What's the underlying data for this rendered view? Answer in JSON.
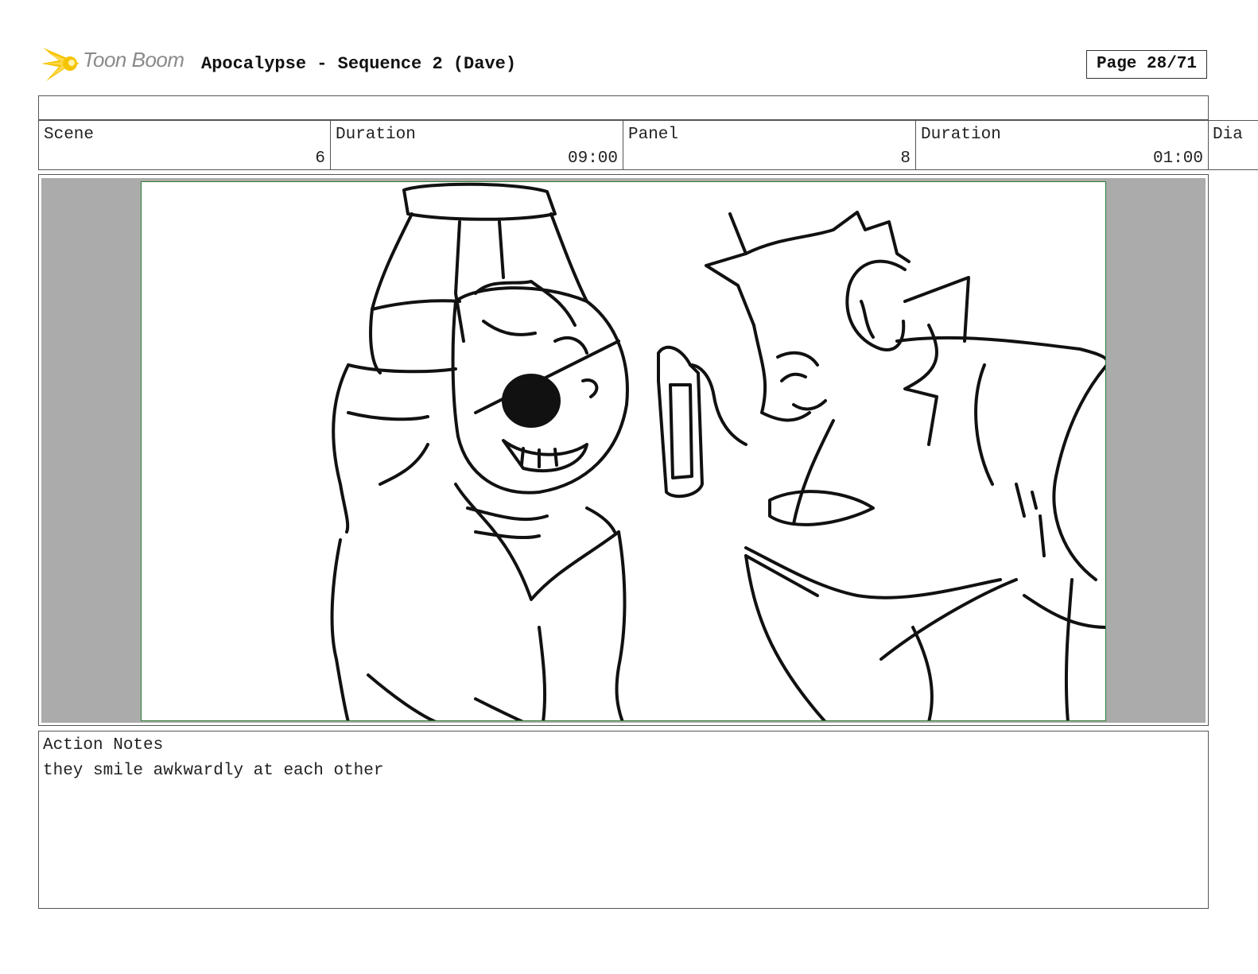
{
  "header": {
    "logo_text": "Toon Boom",
    "title": "Apocalypse - Sequence 2 (Dave)",
    "page": "Page 28/71"
  },
  "meta": {
    "scene_label": "Scene",
    "scene_value": "6",
    "scene_duration_label": "Duration",
    "scene_duration_value": "09:00",
    "panel_label": "Panel",
    "panel_value": "8",
    "panel_duration_label": "Duration",
    "panel_duration_value": "01:00",
    "dialog_label": "Dia"
  },
  "notes": {
    "label": "Action Notes",
    "text": "they smile awkwardly at each other"
  },
  "colors": {
    "panel_border": "#2e7d32",
    "panel_background": "#ababab",
    "logo_accent": "#f5c400"
  }
}
